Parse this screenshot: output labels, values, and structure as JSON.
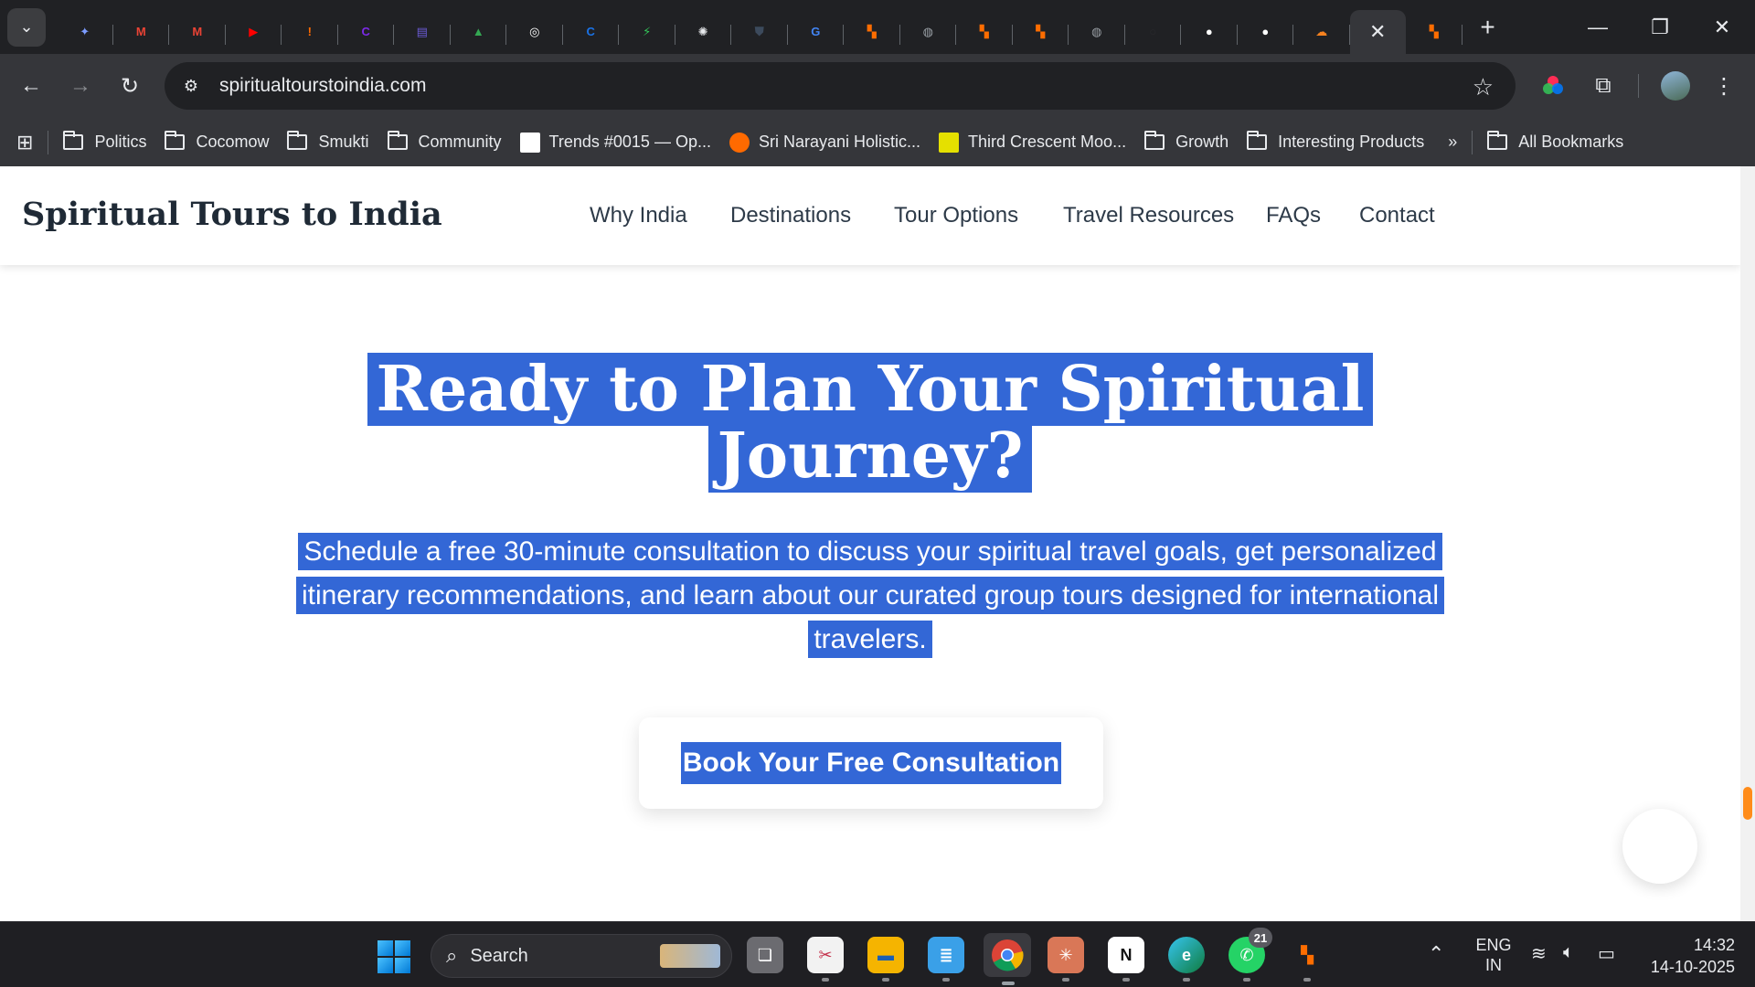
{
  "browser": {
    "tabs": [
      {
        "icon": "gemini-icon",
        "color": "#7c9cff",
        "glyph": "✦"
      },
      {
        "icon": "gmail-icon",
        "color": "#ea4335",
        "glyph": "M"
      },
      {
        "icon": "gmail-icon",
        "color": "#ea4335",
        "glyph": "M"
      },
      {
        "icon": "youtube-icon",
        "color": "#ff0000",
        "glyph": "▶"
      },
      {
        "icon": "sri-narayani-icon",
        "color": "#ff6a00",
        "glyph": "!"
      },
      {
        "icon": "canva-icon",
        "color": "#7d2ae8",
        "glyph": "C"
      },
      {
        "icon": "calendar-app-icon",
        "color": "#6b5bd6",
        "glyph": "▤"
      },
      {
        "icon": "google-drive-icon",
        "color": "#34a853",
        "glyph": "▲"
      },
      {
        "icon": "spiral-icon",
        "color": "#ffffff",
        "glyph": "◎"
      },
      {
        "icon": "blue-c-icon",
        "color": "#1a73e8",
        "glyph": "C"
      },
      {
        "icon": "bolt-icon",
        "color": "#34c759",
        "glyph": "⚡"
      },
      {
        "icon": "openai-icon",
        "color": "#e8eaed",
        "glyph": "✺"
      },
      {
        "icon": "shield-dark-icon",
        "color": "#3c4a5c",
        "glyph": "⛊"
      },
      {
        "icon": "google-icon",
        "color": "#4285f4",
        "glyph": "G"
      },
      {
        "icon": "orange-blocks-icon",
        "color": "#ff6d00",
        "glyph": "▚"
      },
      {
        "icon": "globe-icon",
        "color": "#9aa0a6",
        "glyph": "◍"
      },
      {
        "icon": "orange-blocks-icon",
        "color": "#ff6d00",
        "glyph": "▚"
      },
      {
        "icon": "orange-blocks-icon",
        "color": "#ff6d00",
        "glyph": "▚"
      },
      {
        "icon": "globe-icon",
        "color": "#9aa0a6",
        "glyph": "◍"
      },
      {
        "icon": "dark-circle-icon",
        "color": "#2a2a2e",
        "glyph": "○"
      },
      {
        "icon": "github-icon",
        "color": "#ffffff",
        "glyph": "●"
      },
      {
        "icon": "github-icon",
        "color": "#ffffff",
        "glyph": "●"
      },
      {
        "icon": "cloudflare-icon",
        "color": "#f6821f",
        "glyph": "☁"
      },
      {
        "icon": "close-icon",
        "color": "#e8eaed",
        "glyph": "✕",
        "active": true
      },
      {
        "icon": "orange-blocks-icon",
        "color": "#ff6d00",
        "glyph": "▚"
      }
    ],
    "url": "spiritualtourstoindia.com",
    "bookmarks": [
      {
        "type": "folder",
        "label": "Politics"
      },
      {
        "type": "folder",
        "label": "Cocomow"
      },
      {
        "type": "folder",
        "label": "Smukti"
      },
      {
        "type": "folder",
        "label": "Community"
      },
      {
        "type": "site",
        "label": "Trends #0015 — Op...",
        "icon": "trends-icon",
        "color": "#ffffff"
      },
      {
        "type": "site",
        "label": "Sri Narayani Holistic...",
        "icon": "sri-narayani-icon",
        "color": "#ff6a00"
      },
      {
        "type": "site",
        "label": "Third Crescent Moo...",
        "icon": "letter-a-icon",
        "color": "#e5e000"
      },
      {
        "type": "folder",
        "label": "Growth"
      },
      {
        "type": "folder",
        "label": "Interesting Products"
      }
    ],
    "all_bookmarks": "All Bookmarks"
  },
  "site": {
    "logo": "Spiritual Tours to India",
    "nav": [
      "Why India",
      "Destinations",
      "Tour Options",
      "Travel Resources",
      "FAQs",
      "Contact"
    ],
    "hero": {
      "title_line1": "Ready to Plan Your Spiritual",
      "title_line2": "Journey?",
      "subtitle_line1": "Schedule a free 30-minute consultation to discuss your spiritual travel goals, get personalized",
      "subtitle_line2": "itinerary recommendations, and learn about our curated group tours designed for international",
      "subtitle_line3": "travelers."
    },
    "cta_label": "Book Your Free Consultation",
    "selection_color": "#3367d6",
    "scrollbar_accent": "#ff8c1a",
    "scroll_position": 0.86
  },
  "taskbar": {
    "search_placeholder": "Search",
    "whatsapp_badge": "21",
    "language": "ENG",
    "region": "IN",
    "time": "14:32",
    "date": "14-10-2025"
  }
}
